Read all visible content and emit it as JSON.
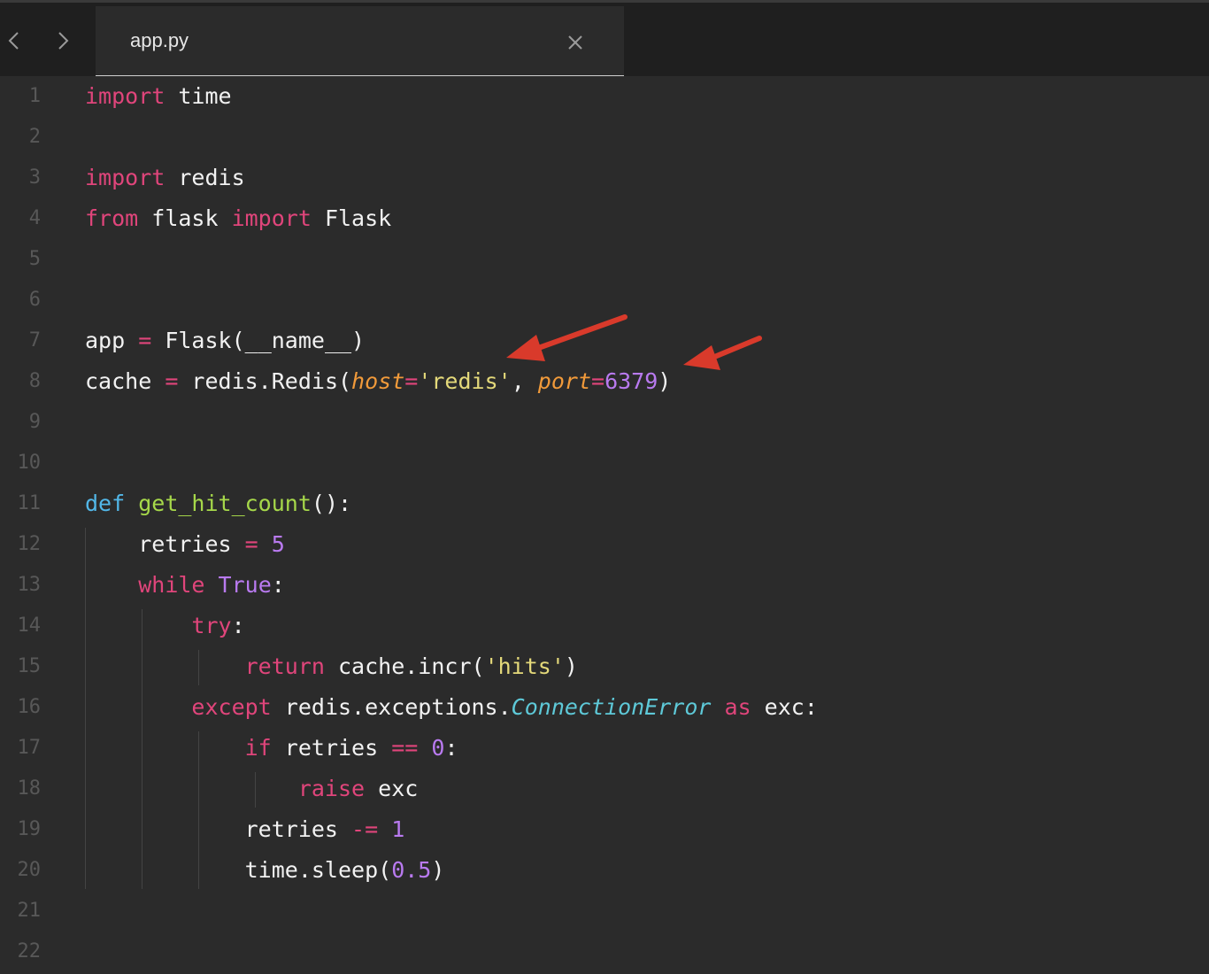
{
  "tab": {
    "title": "app.py"
  },
  "colors": {
    "keyword": "#e0457b",
    "def_keyword": "#52b7e8",
    "function": "#a6d84a",
    "number": "#b97af0",
    "string": "#e4d97a",
    "parameter": "#f19a3a",
    "class_name": "#5ec9d8",
    "arrow": "#d93a2b"
  },
  "icons": {
    "back": "chevron-left-icon",
    "forward": "chevron-right-icon",
    "close": "close-icon"
  },
  "lines": [
    {
      "num": "1"
    },
    {
      "num": "2"
    },
    {
      "num": "3"
    },
    {
      "num": "4"
    },
    {
      "num": "5"
    },
    {
      "num": "6"
    },
    {
      "num": "7"
    },
    {
      "num": "8"
    },
    {
      "num": "9"
    },
    {
      "num": "10"
    },
    {
      "num": "11"
    },
    {
      "num": "12"
    },
    {
      "num": "13"
    },
    {
      "num": "14"
    },
    {
      "num": "15"
    },
    {
      "num": "16"
    },
    {
      "num": "17"
    },
    {
      "num": "18"
    },
    {
      "num": "19"
    },
    {
      "num": "20"
    },
    {
      "num": "21"
    },
    {
      "num": "22"
    }
  ],
  "code": {
    "l1": {
      "t0": "import",
      "t1": " time"
    },
    "l3": {
      "t0": "import",
      "t1": " redis"
    },
    "l4": {
      "t0": "from",
      "t1": " flask ",
      "t2": "import",
      "t3": " Flask"
    },
    "l7": {
      "t0": "app ",
      "t1": "=",
      "t2": " Flask(__name__)"
    },
    "l8": {
      "t0": "cache ",
      "t1": "=",
      "t2": " redis.Redis(",
      "t3": "host",
      "t4": "=",
      "t5": "'redis'",
      "t6": ", ",
      "t7": "port",
      "t8": "=",
      "t9": "6379",
      "t10": ")"
    },
    "l11": {
      "t0": "def",
      "t1": " ",
      "t2": "get_hit_count",
      "t3": "():"
    },
    "l12": {
      "t0": "    retries ",
      "t1": "=",
      "t2": " ",
      "t3": "5"
    },
    "l13": {
      "t0": "    ",
      "t1": "while",
      "t2": " ",
      "t3": "True",
      "t4": ":"
    },
    "l14": {
      "t0": "        ",
      "t1": "try",
      "t2": ":"
    },
    "l15": {
      "t0": "            ",
      "t1": "return",
      "t2": " cache.incr(",
      "t3": "'hits'",
      "t4": ")"
    },
    "l16": {
      "t0": "        ",
      "t1": "except",
      "t2": " redis.exceptions.",
      "t3": "ConnectionError",
      "t4": " ",
      "t5": "as",
      "t6": " exc:"
    },
    "l17": {
      "t0": "            ",
      "t1": "if",
      "t2": " retries ",
      "t3": "==",
      "t4": " ",
      "t5": "0",
      "t6": ":"
    },
    "l18": {
      "t0": "                ",
      "t1": "raise",
      "t2": " exc"
    },
    "l19": {
      "t0": "            retries ",
      "t1": "-=",
      "t2": " ",
      "t3": "1"
    },
    "l20": {
      "t0": "            time.sleep(",
      "t1": "0.5",
      "t2": ")"
    }
  }
}
